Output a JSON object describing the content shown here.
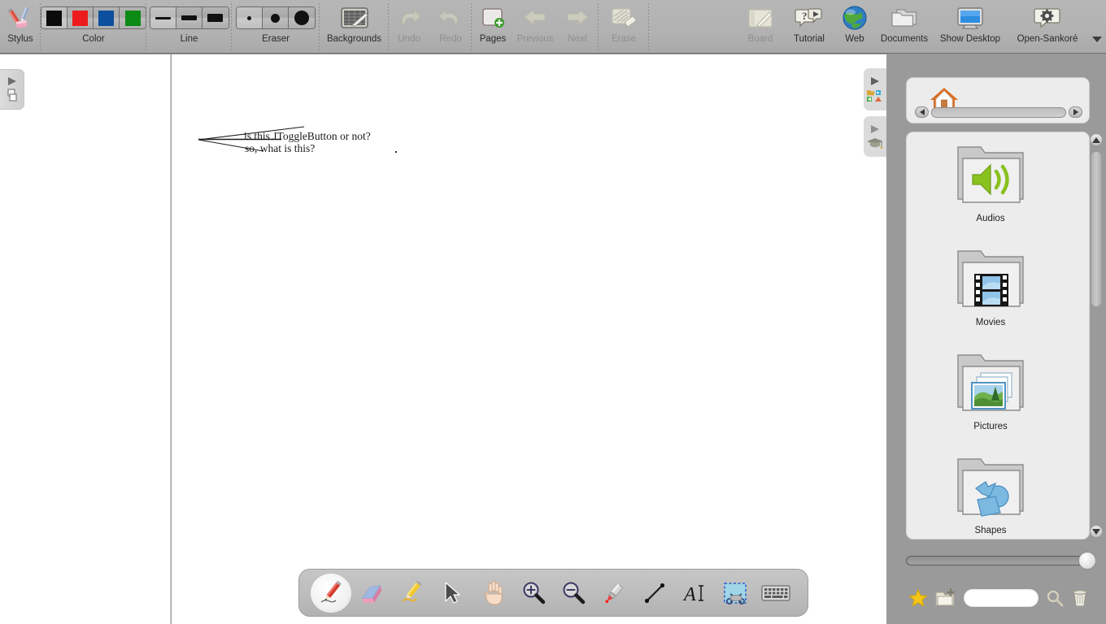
{
  "app": {
    "title": "Open-Sankoré",
    "background_color": "#9a9a9a"
  },
  "toolbar": {
    "groups": [
      {
        "name": "stylus",
        "label": "Stylus",
        "enabled": true
      },
      {
        "name": "color",
        "label": "Color",
        "enabled": true,
        "swatches": [
          {
            "name": "black",
            "hex": "#0b0b0b",
            "selected": true
          },
          {
            "name": "red",
            "hex": "#ec1c1c",
            "selected": false
          },
          {
            "name": "blue",
            "hex": "#0b4f9e",
            "selected": false
          },
          {
            "name": "green",
            "hex": "#0b8a14",
            "selected": false
          }
        ]
      },
      {
        "name": "line",
        "label": "Line",
        "enabled": true,
        "widths": [
          {
            "name": "thin",
            "selected": true
          },
          {
            "name": "medium",
            "selected": false
          },
          {
            "name": "thick",
            "selected": false
          }
        ]
      },
      {
        "name": "eraser",
        "label": "Eraser",
        "enabled": true,
        "sizes": [
          {
            "name": "small",
            "selected": true
          },
          {
            "name": "medium",
            "selected": false
          },
          {
            "name": "large",
            "selected": false
          }
        ]
      },
      {
        "name": "backgrounds",
        "label": "Backgrounds",
        "enabled": true
      },
      {
        "name": "undo",
        "label": "Undo",
        "enabled": false
      },
      {
        "name": "redo",
        "label": "Redo",
        "enabled": false
      },
      {
        "name": "pages",
        "label": "Pages",
        "enabled": true
      },
      {
        "name": "previous",
        "label": "Previous",
        "enabled": false
      },
      {
        "name": "next",
        "label": "Next",
        "enabled": false
      },
      {
        "name": "erase",
        "label": "Erase",
        "enabled": false
      },
      {
        "name": "board",
        "label": "Board",
        "enabled": false
      },
      {
        "name": "tutorial",
        "label": "Tutorial",
        "enabled": true
      },
      {
        "name": "web",
        "label": "Web",
        "enabled": true
      },
      {
        "name": "documents",
        "label": "Documents",
        "enabled": true
      },
      {
        "name": "show-desktop",
        "label": "Show Desktop",
        "enabled": true
      },
      {
        "name": "open-sankore",
        "label": "Open-Sankoré",
        "enabled": true
      }
    ]
  },
  "canvas": {
    "annotation_lines": [
      "is this JToggleButton or not?",
      "so, what is this?"
    ]
  },
  "library": {
    "breadcrumb": {
      "root_icon": "home-icon",
      "back_label": "◀",
      "forward_label": "▶"
    },
    "items": [
      {
        "name": "audios",
        "label": "Audios"
      },
      {
        "name": "movies",
        "label": "Movies"
      },
      {
        "name": "pictures",
        "label": "Pictures"
      },
      {
        "name": "shapes",
        "label": "Shapes"
      }
    ],
    "zoom_slider": {
      "value": 100,
      "min": 0,
      "max": 100
    },
    "actions": [
      {
        "name": "favorites",
        "icon": "star-icon"
      },
      {
        "name": "new-folder",
        "icon": "new-folder-icon"
      },
      {
        "name": "search",
        "icon": "search-input"
      },
      {
        "name": "search-button",
        "icon": "magnifier-icon"
      },
      {
        "name": "delete",
        "icon": "trash-icon"
      }
    ],
    "search_value": "",
    "search_placeholder": ""
  },
  "palette": {
    "tools": [
      {
        "name": "pen",
        "icon": "pen-icon",
        "selected": true
      },
      {
        "name": "eraser",
        "icon": "eraser-icon",
        "selected": false
      },
      {
        "name": "marker",
        "icon": "highlighter-icon",
        "selected": false
      },
      {
        "name": "selector",
        "icon": "arrow-cursor-icon",
        "selected": false
      },
      {
        "name": "hand",
        "icon": "hand-icon",
        "selected": false
      },
      {
        "name": "zoom-in",
        "icon": "magnifier-plus-icon",
        "selected": false
      },
      {
        "name": "zoom-out",
        "icon": "magnifier-minus-icon",
        "selected": false
      },
      {
        "name": "laser",
        "icon": "laser-pointer-icon",
        "selected": false
      },
      {
        "name": "line",
        "icon": "line-icon",
        "selected": false
      },
      {
        "name": "text",
        "icon": "text-a-icon",
        "selected": false
      },
      {
        "name": "capture",
        "icon": "scissors-capture-icon",
        "selected": false
      },
      {
        "name": "virtual-keyboard",
        "icon": "keyboard-icon",
        "selected": false
      }
    ]
  },
  "handles": {
    "left": {
      "name": "page-panel-handle"
    },
    "right_library": {
      "name": "library-panel-handle"
    },
    "right_tutorial": {
      "name": "tutorial-panel-handle"
    }
  }
}
